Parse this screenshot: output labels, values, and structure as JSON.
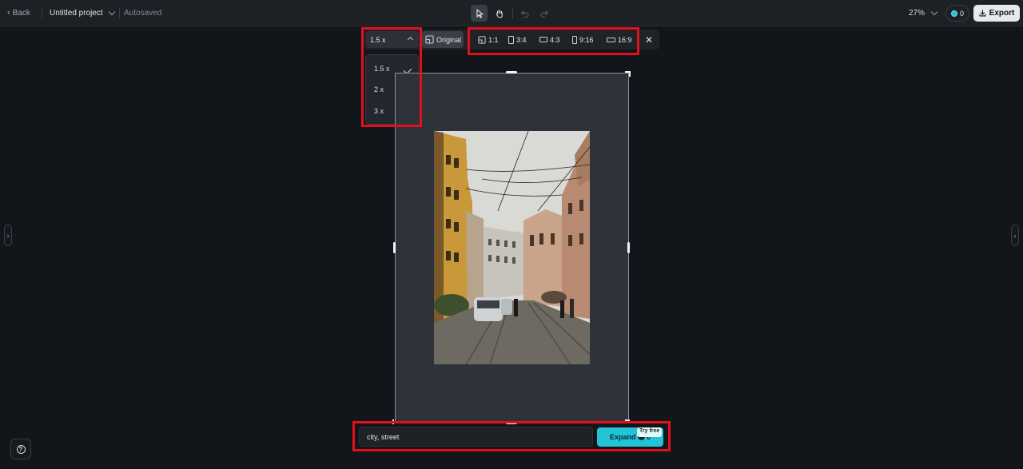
{
  "header": {
    "back_label": "Back",
    "project_name": "Untitled project",
    "save_status": "Autosaved",
    "zoom": "27%",
    "credits": "0",
    "export_label": "Export"
  },
  "toolbar": {
    "scale_value": "1.5 x",
    "original_label": "Original",
    "ratios": [
      "1:1",
      "3:4",
      "4:3",
      "9:16",
      "16:9"
    ]
  },
  "scale_menu": {
    "options": [
      "1.5 x",
      "2 x",
      "3 x"
    ],
    "selected": "1.5 x"
  },
  "prompt": {
    "value": "city, street",
    "expand_label": "Expand",
    "expand_cost": "0",
    "badge": "Try free"
  },
  "colors": {
    "accent": "#22c3d6",
    "highlight": "#e3101c",
    "background": "#121519"
  }
}
